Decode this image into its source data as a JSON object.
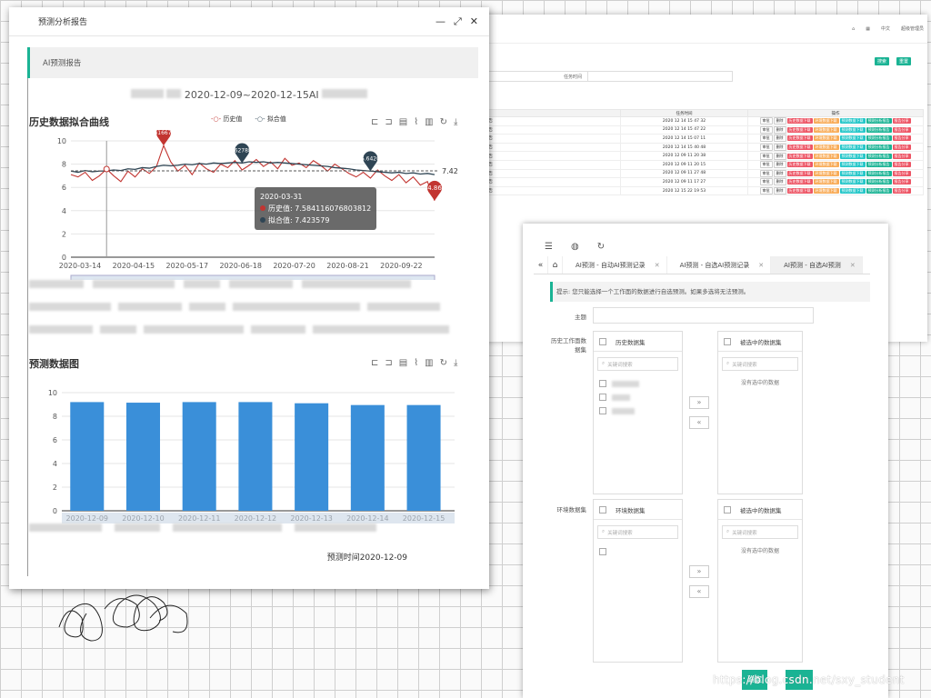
{
  "back_window": {
    "top_links": [
      "中文",
      "超级管理员"
    ],
    "search_btn": "搜索",
    "reset_btn": "重置",
    "field_label": "任务时间",
    "th_time": "任务时间",
    "th_ops": "操作",
    "rows": [
      {
        "name": "报告",
        "time": "2020 12 14 15 47 32"
      },
      {
        "name": "报告",
        "time": "2020 12 14 15 47 22"
      },
      {
        "name": "报告",
        "time": "2020 12 14 15 07 11"
      },
      {
        "name": "报告",
        "time": "2020 12 14 15 40 48"
      },
      {
        "name": "报告",
        "time": "2020 12 09 11 20 38"
      },
      {
        "name": "报告",
        "time": "2020 12 09 11 20 15"
      },
      {
        "name": "报告",
        "time": "2020 12 09 11 27 48"
      },
      {
        "name": "报告",
        "time": "2020 12 09 11 17 27"
      },
      {
        "name": "报告",
        "time": "2020 12 15 22 19 53"
      }
    ],
    "ops": [
      "审批",
      "删除",
      "历史数据下载",
      "环境数据下载",
      "预测数据下载",
      "预测分析报告",
      "报告分享"
    ]
  },
  "report_window": {
    "title": "预测分析报告",
    "section_tab": "AI预测报告",
    "report_heading": "2020-12-09~2020-12-15AI",
    "predict_time": "预测时间2020-12-09"
  },
  "chart_data": [
    {
      "type": "line",
      "title": "历史数据拟合曲线",
      "legend": [
        "历史值",
        "拟合值"
      ],
      "x_ticks": [
        "2020-03-14",
        "2020-04-15",
        "2020-05-17",
        "2020-06-18",
        "2020-07-20",
        "2020-08-21",
        "2020-09-22"
      ],
      "y_ticks": [
        0,
        2,
        4,
        6,
        8,
        10
      ],
      "ylim": [
        0,
        10
      ],
      "series": [
        {
          "name": "历史值",
          "color": "#c23531",
          "values": [
            7.1,
            6.9,
            7.3,
            6.6,
            7.0,
            7.58,
            7.0,
            6.5,
            7.4,
            6.9,
            7.6,
            7.2,
            7.8,
            9.6,
            8.2,
            7.4,
            7.9,
            7.1,
            8.1,
            7.6,
            7.3,
            8.0,
            7.7,
            8.3,
            7.5,
            7.9,
            8.4,
            7.8,
            8.2,
            7.6,
            8.5,
            7.9,
            8.1,
            7.7,
            8.3,
            7.9,
            7.4,
            8.0,
            7.6,
            7.2,
            6.9,
            7.3,
            6.8,
            7.5,
            7.0,
            6.6,
            7.1,
            6.4,
            6.9,
            6.2,
            6.5,
            4.86
          ]
        },
        {
          "name": "拟合值",
          "color": "#2f4554",
          "values": [
            7.4,
            7.3,
            7.45,
            7.35,
            7.4,
            7.42,
            7.5,
            7.45,
            7.6,
            7.55,
            7.7,
            7.65,
            7.8,
            7.9,
            7.85,
            7.9,
            8.0,
            7.95,
            8.05,
            8.0,
            8.1,
            8.05,
            8.1,
            8.15,
            8.1,
            8.2,
            8.15,
            8.2,
            8.1,
            8.15,
            8.1,
            8.05,
            8.0,
            7.95,
            7.9,
            7.85,
            7.8,
            7.7,
            7.65,
            7.6,
            7.5,
            7.45,
            7.4,
            7.35,
            7.3,
            7.25,
            7.3,
            7.2,
            7.25,
            7.15,
            7.2,
            7.1
          ]
        }
      ],
      "markers": [
        {
          "label": "9.6166781",
          "color": "#c23531"
        },
        {
          "label": "8.627881",
          "color": "#2f4554"
        },
        {
          "label": "6.6420",
          "color": "#2f4554"
        },
        {
          "label": "4.86",
          "color": "#c23531"
        }
      ],
      "avg_label": "7.42",
      "tooltip": {
        "date": "2020-03-31",
        "hist_label": "历史值: 7.584116076803812",
        "fit_label": "拟合值: 7.423579"
      }
    },
    {
      "type": "bar",
      "title": "预测数据图",
      "categories": [
        "2020-12-09",
        "2020-12-10",
        "2020-12-11",
        "2020-12-12",
        "2020-12-13",
        "2020-12-14",
        "2020-12-15"
      ],
      "values": [
        9.2,
        9.15,
        9.2,
        9.2,
        9.1,
        8.95,
        8.95
      ],
      "y_ticks": [
        0,
        2,
        4,
        6,
        8,
        10
      ],
      "ylim": [
        0,
        10
      ],
      "color": "#3a8fd9"
    }
  ],
  "selection_window": {
    "tabs": [
      "AI预测 - 自动AI预测记录",
      "AI预测 - 自选AI预测记录",
      "AI预测 - 自选AI预测"
    ],
    "hint": "提示: 您只能选择一个工作面的数据进行自选预测。如果多选将无法预测。",
    "subject_label": "主题",
    "hist_label": "历史工作面数据集",
    "env_label": "环境数据集",
    "panel_hist": "历史数据集",
    "panel_env": "环境数据集",
    "panel_selected": "被选中的数据集",
    "search_placeholder": "关键词搜索",
    "no_selection": "没有选中的数据",
    "ok_button": "确定"
  },
  "watermark": "https://blog.csdn.net/sxy_student"
}
